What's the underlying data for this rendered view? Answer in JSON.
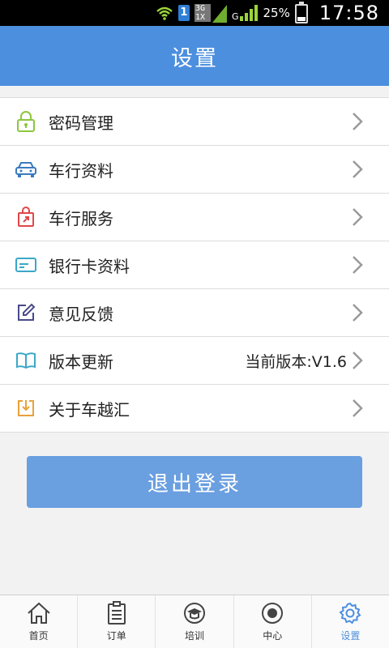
{
  "status_bar": {
    "network_label": "3G\n1X",
    "g_label": "G",
    "battery": "25%",
    "time": "17:58"
  },
  "header": {
    "title": "设置"
  },
  "menu": {
    "items": [
      {
        "label": "密码管理",
        "icon": "lock-icon",
        "value": ""
      },
      {
        "label": "车行资料",
        "icon": "car-icon",
        "value": ""
      },
      {
        "label": "车行服务",
        "icon": "shopping-bag-icon",
        "value": ""
      },
      {
        "label": "银行卡资料",
        "icon": "bank-card-icon",
        "value": ""
      },
      {
        "label": "意见反馈",
        "icon": "edit-icon",
        "value": ""
      },
      {
        "label": "版本更新",
        "icon": "book-icon",
        "value": "当前版本:V1.6"
      },
      {
        "label": "关于车越汇",
        "icon": "download-icon",
        "value": ""
      }
    ]
  },
  "logout": {
    "label": "退出登录"
  },
  "bottom_nav": {
    "tabs": [
      {
        "label": "首页",
        "icon": "home-icon"
      },
      {
        "label": "订单",
        "icon": "order-list-icon"
      },
      {
        "label": "培训",
        "icon": "graduation-cap-icon"
      },
      {
        "label": "中心",
        "icon": "target-icon"
      },
      {
        "label": "设置",
        "icon": "gear-icon"
      }
    ],
    "active_tab": "设置"
  },
  "colors": {
    "header_bg": "#4c8fdf",
    "logout_bg": "#6a9fe0",
    "active_tab": "#4c8fdf"
  }
}
